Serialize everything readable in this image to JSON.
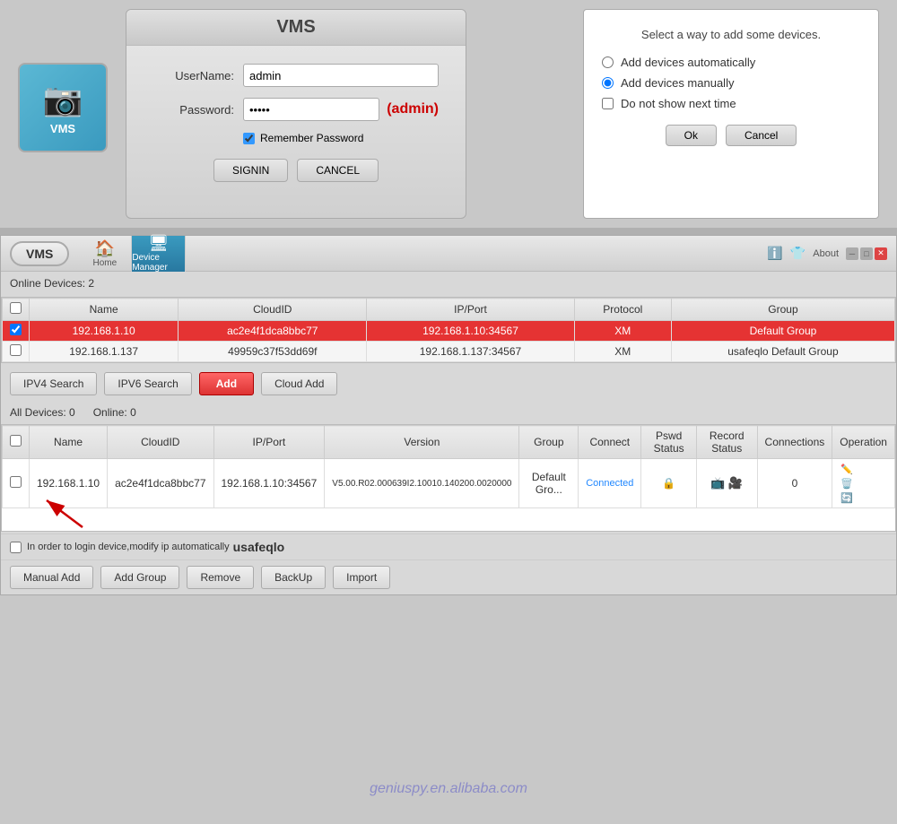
{
  "top": {
    "logo_label": "VMS",
    "login": {
      "title": "VMS",
      "username_label": "UserName:",
      "username_value": "admin",
      "password_label": "Password:",
      "password_value": "•••••",
      "password_hint": "(admin)",
      "remember_label": "Remember Password",
      "signin_label": "SIGNIN",
      "cancel_label": "CANCEL"
    },
    "add_devices": {
      "title": "Select a way to add some devices.",
      "option1": "Add devices automatically",
      "option2": "Add devices manually",
      "option3": "Do not show next time",
      "ok_label": "Ok",
      "cancel_label": "Cancel"
    }
  },
  "app": {
    "title": "VMS",
    "nav": {
      "home_label": "Home",
      "device_manager_label": "Device Manager"
    },
    "about_label": "About",
    "online_devices_label": "Online Devices:",
    "online_devices_count": "2",
    "online_table": {
      "headers": [
        "Name",
        "CloudID",
        "IP/Port",
        "Protocol",
        "Group"
      ],
      "rows": [
        {
          "name": "192.168.1.10",
          "cloud_id": "ac2e4f1dca8bbc77",
          "ip_port": "192.168.1.10:34567",
          "protocol": "XM",
          "group": "Default Group"
        },
        {
          "name": "192.168.1.137",
          "cloud_id": "49959c37f53dd69f",
          "ip_port": "192.168.1.137:34567",
          "protocol": "XM",
          "group": "usafeqlo Default Group"
        }
      ]
    },
    "action_buttons": {
      "ipv4": "IPV4 Search",
      "ipv6": "IPV6 Search",
      "add": "Add",
      "cloud_add": "Cloud Add"
    },
    "all_devices_label": "All Devices:",
    "all_devices_count": "0",
    "online_label": "Online:",
    "online_count": "0",
    "all_table": {
      "headers": [
        "Name",
        "CloudID",
        "IP/Port",
        "Version",
        "Group",
        "Connect",
        "Pswd Status",
        "Record Status",
        "Connections",
        "Operation"
      ],
      "rows": [
        {
          "name": "192.168.1.10",
          "cloud_id": "ac2e4f1dca8bbc77",
          "ip_port": "192.168.1.10:34567",
          "version": "V5.00.R02.000639I2.10010.140200.0020000",
          "group": "Default Gro...",
          "connect": "Connected",
          "pswd_status": "🔴",
          "record_status": "📷",
          "connections": "0"
        }
      ]
    },
    "bottom_checkbox_label": "In order to login device,modify ip automatically",
    "bottom_usafeqlo": "usafeqlo",
    "bottom_buttons": {
      "manual_add": "Manual Add",
      "add_group": "Add Group",
      "remove": "Remove",
      "backup": "BackUp",
      "import": "Import"
    }
  },
  "watermark": "geniuspy.en.alibaba.com"
}
